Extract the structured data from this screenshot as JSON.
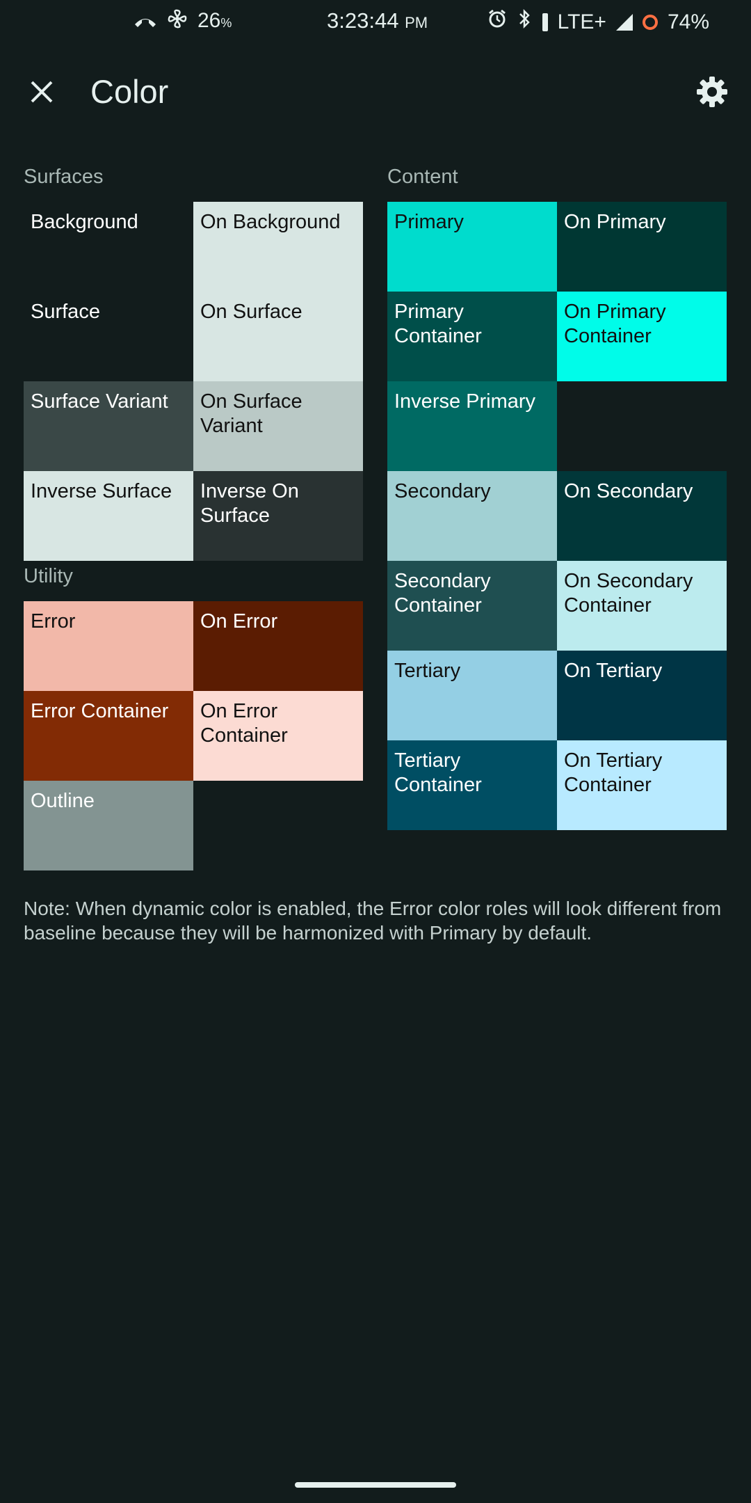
{
  "status_bar": {
    "battery_small": "26",
    "battery_small_pct": "%",
    "time": "3:23:44",
    "ampm": "PM",
    "network": "LTE+",
    "battery": "74%"
  },
  "appbar": {
    "title": "Color",
    "close_icon": "close-icon",
    "settings_icon": "gear-icon"
  },
  "surfaces": {
    "label": "Surfaces",
    "tiles": [
      {
        "label": "Background",
        "bg": "#121c1c",
        "fg": "#ffffff"
      },
      {
        "label": "On Background",
        "bg": "#d8e6e3",
        "fg": "#111111"
      },
      {
        "label": "Surface",
        "bg": "#121c1c",
        "fg": "#ffffff"
      },
      {
        "label": "On Surface",
        "bg": "#d8e6e3",
        "fg": "#111111"
      },
      {
        "label": "Surface Variant",
        "bg": "#3a4847",
        "fg": "#ffffff"
      },
      {
        "label": "On Surface Variant",
        "bg": "#bac9c6",
        "fg": "#111111"
      },
      {
        "label": "Inverse Surface",
        "bg": "#d8e6e3",
        "fg": "#111111"
      },
      {
        "label": "Inverse On Surface",
        "bg": "#293232",
        "fg": "#ffffff"
      }
    ]
  },
  "utility": {
    "label": "Utility",
    "tiles": [
      {
        "label": "Error",
        "bg": "#f2b8a9",
        "fg": "#111111"
      },
      {
        "label": "On Error",
        "bg": "#5b1c02",
        "fg": "#ffffff"
      },
      {
        "label": "Error Container",
        "bg": "#822b05",
        "fg": "#ffffff"
      },
      {
        "label": "On Error Container",
        "bg": "#fcdbd3",
        "fg": "#111111"
      },
      {
        "label": "Outline",
        "bg": "#839492",
        "fg": "#ffffff"
      }
    ]
  },
  "content": {
    "label": "Content",
    "tiles": [
      {
        "label": "Primary",
        "bg": "#00dccd",
        "fg": "#111111"
      },
      {
        "label": "On Primary",
        "bg": "#003733",
        "fg": "#ffffff"
      },
      {
        "label": "Primary Container",
        "bg": "#004f4a",
        "fg": "#ffffff"
      },
      {
        "label": "On Primary Container",
        "bg": "#00fce9",
        "fg": "#111111"
      },
      {
        "label": "Inverse Primary",
        "bg": "#006a63",
        "fg": "#ffffff"
      },
      {
        "label": "Secondary",
        "bg": "#a1d0d3",
        "fg": "#111111"
      },
      {
        "label": "On Secondary",
        "bg": "#013739",
        "fg": "#ffffff"
      },
      {
        "label": "Secondary Container",
        "bg": "#1f4f51",
        "fg": "#ffffff"
      },
      {
        "label": "On Secondary Container",
        "bg": "#bcebee",
        "fg": "#111111"
      },
      {
        "label": "Tertiary",
        "bg": "#94cfe4",
        "fg": "#111111"
      },
      {
        "label": "On Tertiary",
        "bg": "#003545",
        "fg": "#ffffff"
      },
      {
        "label": "Tertiary Container",
        "bg": "#004e63",
        "fg": "#ffffff"
      },
      {
        "label": "On Tertiary Container",
        "bg": "#b8eaff",
        "fg": "#111111"
      }
    ]
  },
  "note": "Note: When dynamic color is enabled, the Error color roles will look different from baseline because they will be harmonized with Primary by default."
}
